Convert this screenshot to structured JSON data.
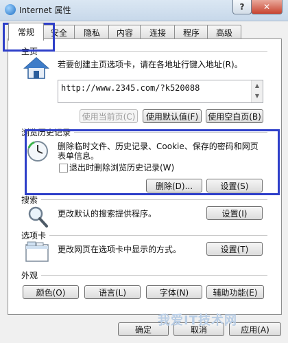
{
  "window": {
    "title": "Internet 属性",
    "help_label": "?",
    "close_label": "✕"
  },
  "tabs": [
    "常规",
    "安全",
    "隐私",
    "内容",
    "连接",
    "程序",
    "高级"
  ],
  "homepage": {
    "label": "主页",
    "description": "若要创建主页选项卡，请在各地址行键入地址(R)。",
    "url": "http://www.2345.com/?k520088",
    "buttons": {
      "use_current": "使用当前页(C)",
      "use_default": "使用默认值(F)",
      "use_blank": "使用空白页(B)"
    }
  },
  "history": {
    "label": "浏览历史记录",
    "description_line1": "删除临时文件、历史记录、Cookie、保存的密码和网页",
    "description_line2": "表单信息。",
    "checkbox_label": "退出时删除浏览历史记录(W)",
    "delete_button": "删除(D)...",
    "settings_button": "设置(S)"
  },
  "search": {
    "label": "搜索",
    "description": "更改默认的搜索提供程序。",
    "settings_button": "设置(I)"
  },
  "tabs_section": {
    "label": "选项卡",
    "description": "更改网页在选项卡中显示的方式。",
    "settings_button": "设置(T)"
  },
  "appearance": {
    "label": "外观",
    "buttons": [
      "颜色(O)",
      "语言(L)",
      "字体(N)",
      "辅助功能(E)"
    ]
  },
  "footer": {
    "ok": "确定",
    "cancel": "取消",
    "apply": "应用(A)"
  },
  "watermark": "我爱IT技术网",
  "colors": {
    "highlight": "#2e3fc9",
    "close_red": "#c8432f"
  }
}
